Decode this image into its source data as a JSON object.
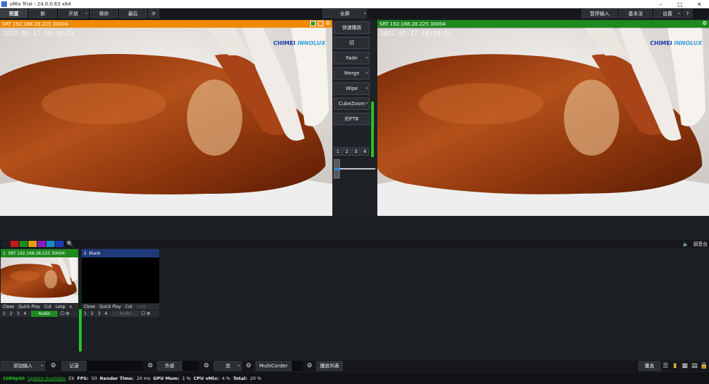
{
  "window": {
    "title": "vMix Trial - 24.0.0.63 x64",
    "minimize": "–",
    "maximize": "□",
    "close": "✕"
  },
  "toolbar": {
    "preview_tab": "预置",
    "new_btn": "新",
    "open_btn": "开放",
    "save_btn": "保存",
    "last_btn": "最后",
    "fullscreen_btn": "全屏",
    "pause_input_btn": "暂停输入",
    "basics_btn": "基本法",
    "settings_btn": "设置",
    "help_btn": "?"
  },
  "preview": {
    "source": "SRT 192.168.28.225 30004",
    "timestamp": "2022-05-17 10:39:21",
    "watermark_a": "CHIMEI",
    "watermark_b": "INNOLUX"
  },
  "output": {
    "source": "SRT 192.168.28.225 30004",
    "timestamp": "2022-05-17 10:39:21",
    "watermark_a": "CHIMEI",
    "watermark_b": "INNOLUX"
  },
  "transitions": {
    "quick_play": "快速播放",
    "cut": "切",
    "fade": "Fade",
    "merge": "Merge",
    "wipe": "Wipe",
    "cubezoom": "CubeZoom",
    "ftb": "的FTB",
    "nums": [
      "1",
      "2",
      "3",
      "4"
    ],
    "tbar_position": 0
  },
  "audio_levels": {
    "master": 0.95,
    "input1": 0.62
  },
  "colorbar": {
    "swatches": [
      "#1c1f24",
      "#c41a1a",
      "#1e8a1e",
      "#e0a010",
      "#8a1ac4",
      "#1a8ac4",
      "#1a3bb0"
    ],
    "mixer_label": "调音台"
  },
  "inputs": [
    {
      "number": "1",
      "title": "SRT 192.168.28.225 30004",
      "header_color": "#1e8a1e",
      "close": "Close",
      "quickplay": "Quick Play",
      "cut": "Cut",
      "loop": "Loop",
      "nums": [
        "1",
        "2",
        "3",
        "4"
      ],
      "audio": "Audio",
      "audio_active": true
    },
    {
      "number": "2",
      "title": "Blank",
      "header_color": "#1e3a7a",
      "close": "Close",
      "quickplay": "Quick Play",
      "cut": "Cut",
      "loop": "Loop",
      "nums": [
        "1",
        "2",
        "3",
        "4"
      ],
      "audio": "Audio",
      "audio_active": false
    }
  ],
  "bottombar": {
    "add_input": "添加输入",
    "record": "记录",
    "external": "外部",
    "stream": "流",
    "multicorder": "MultiCorder",
    "playlist": "播放列表",
    "overlay": "覆盖"
  },
  "status": {
    "format": "1080p50",
    "update": "Update Available",
    "ex": "EX",
    "fps_label": "FPS:",
    "fps": "50",
    "render_label": "Render Time:",
    "render": "20 ms",
    "gpu_label": "GPU Mem:",
    "gpu": "1 %",
    "cpu_label": "CPU vMix:",
    "cpu": "4 %",
    "total_label": "Total:",
    "total": "20 %"
  }
}
